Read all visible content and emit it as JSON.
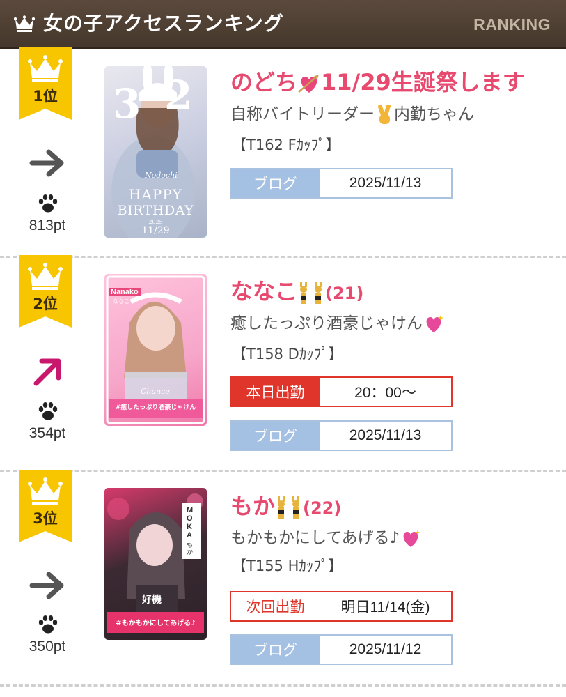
{
  "header": {
    "title": "女の子アクセスランキング",
    "tag": "RANKING"
  },
  "colors": {
    "header_bg": "#4f4034",
    "name": "#e84a6f",
    "blog_label": "#a4c0e2",
    "attendance_red": "#e0352b",
    "badge_gold": "#f7c600"
  },
  "entries": [
    {
      "rank": "1位",
      "trend": "arrow-right-icon",
      "points": "813pt",
      "name": "のどち",
      "name_suffix": "11/29生誕祭します",
      "catch": "自称バイトリーダー",
      "catch_suffix": "内勤ちゃん",
      "spec": "【T162 Fｶｯﾌﾟ】",
      "photo_text": [
        "3",
        "2",
        "Nodochi",
        "HAPPY",
        "BIRTHDAY",
        "2025",
        "11/29"
      ],
      "blog_label": "ブログ",
      "blog_date": "2025/11/13"
    },
    {
      "rank": "2位",
      "trend": "arrow-up-right-icon",
      "points": "354pt",
      "name": "ななこ",
      "name_suffix": "(21)",
      "catch": "癒したっぷり酒豪じゃけん",
      "spec": "【T158 Dｶｯﾌﾟ】",
      "photo_text": [
        "Nanako",
        "ななこ",
        "Chance",
        "#癒したっぷり酒豪じゃけん"
      ],
      "attendance_label": "本日出勤",
      "attendance_value": "20：00〜",
      "blog_label": "ブログ",
      "blog_date": "2025/11/13"
    },
    {
      "rank": "3位",
      "trend": "arrow-right-icon",
      "points": "350pt",
      "name": "もか",
      "name_suffix": "(22)",
      "catch": "もかもかにしてあげる♪",
      "spec": "【T155 Hｶｯﾌﾟ】",
      "photo_text": [
        "MOKA",
        "もか",
        "好機",
        "#もかもかにしてあげる♪"
      ],
      "attendance_label": "次回出勤",
      "attendance_value": "明日11/14(金)",
      "blog_label": "ブログ",
      "blog_date": "2025/11/12"
    }
  ]
}
